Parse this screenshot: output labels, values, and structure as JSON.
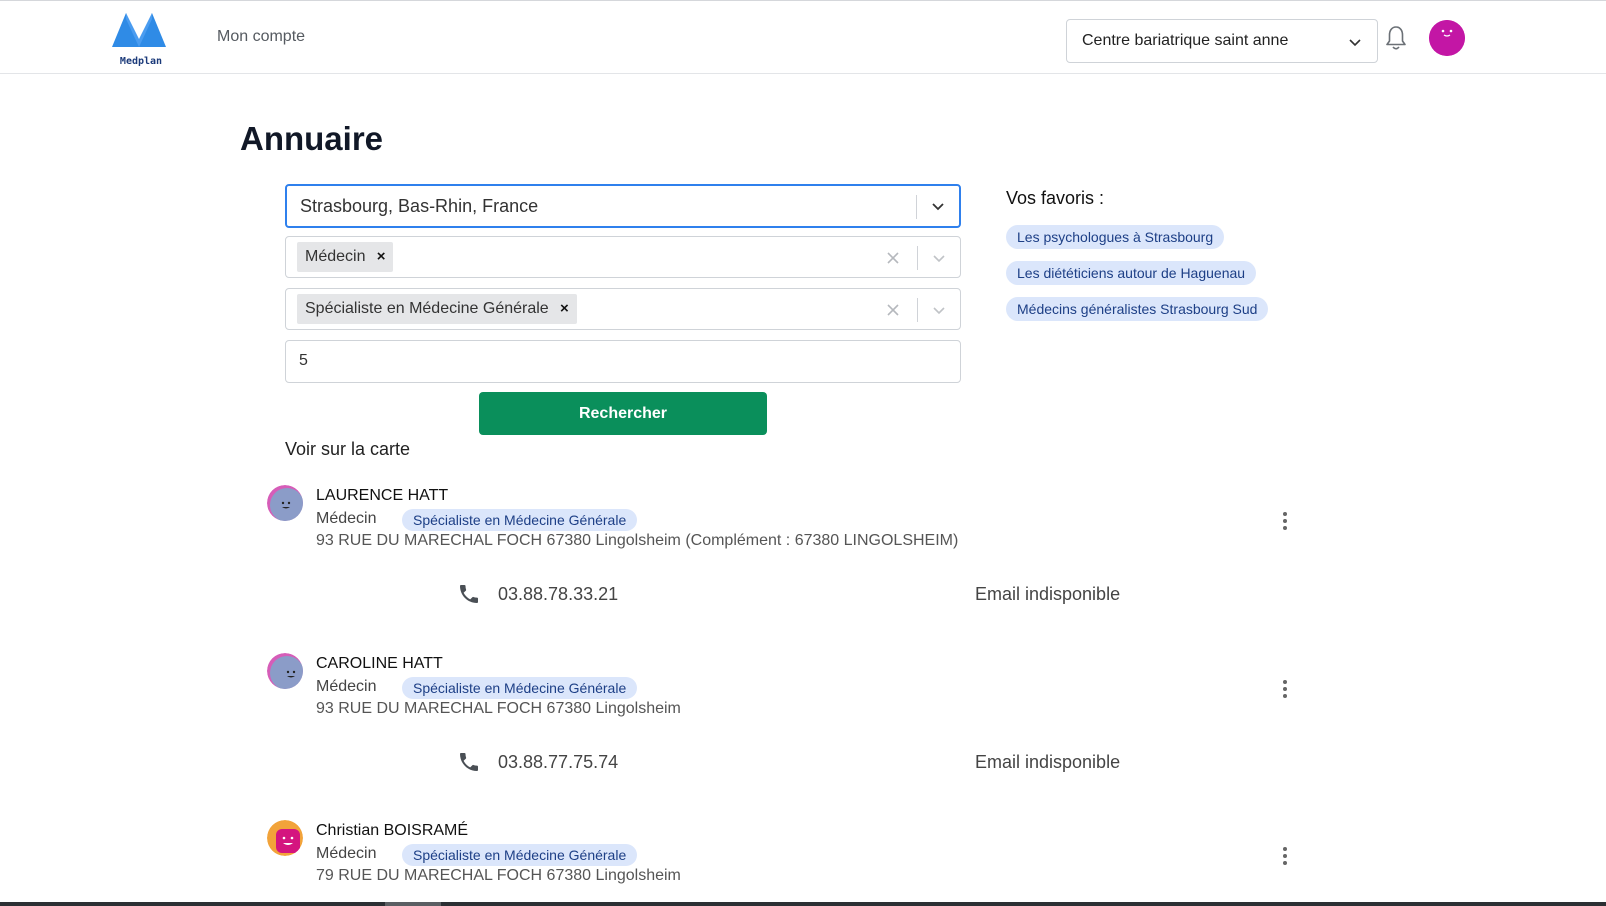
{
  "header": {
    "logo_text": "Medplan",
    "nav_account": "Mon compte",
    "center_select": "Centre bariatrique saint anne",
    "brand_color": "#2f8be6",
    "user_avatar_color": "#c316a5"
  },
  "page": {
    "title": "Annuaire"
  },
  "search": {
    "location": "Strasbourg, Bas-Rhin, France",
    "profession_chip": "Médecin",
    "specialty_chip": "Spécialiste en Médecine Générale",
    "radius": "5",
    "button": "Rechercher",
    "map_link": "Voir sur la carte"
  },
  "favorites": {
    "title": "Vos favoris :",
    "items": [
      "Les psychologues à Strasbourg",
      "Les diététiciens autour de Haguenau",
      "Médecins généralistes Strasbourg Sud"
    ]
  },
  "results": [
    {
      "name": "LAURENCE HATT",
      "profession": "Médecin",
      "specialty": "Spécialiste en Médecine Générale",
      "address": "93 RUE DU MARECHAL FOCH 67380 Lingolsheim (Complément : 67380 LINGOLSHEIM)",
      "phone": "03.88.78.33.21",
      "email": "Email indisponible"
    },
    {
      "name": "CAROLINE HATT",
      "profession": "Médecin",
      "specialty": "Spécialiste en Médecine Générale",
      "address": "93 RUE DU MARECHAL FOCH 67380 Lingolsheim",
      "phone": "03.88.77.75.74",
      "email": "Email indisponible"
    },
    {
      "name": "Christian BOISRAMÉ",
      "profession": "Médecin",
      "specialty": "Spécialiste en Médecine Générale",
      "address": "79 RUE DU MARECHAL FOCH 67380 Lingolsheim"
    }
  ],
  "colors": {
    "primary_button": "#0a8f5b",
    "focus_border": "#2f80ed",
    "tag_bg": "#dbe6fb",
    "tag_text": "#1d3f86"
  }
}
